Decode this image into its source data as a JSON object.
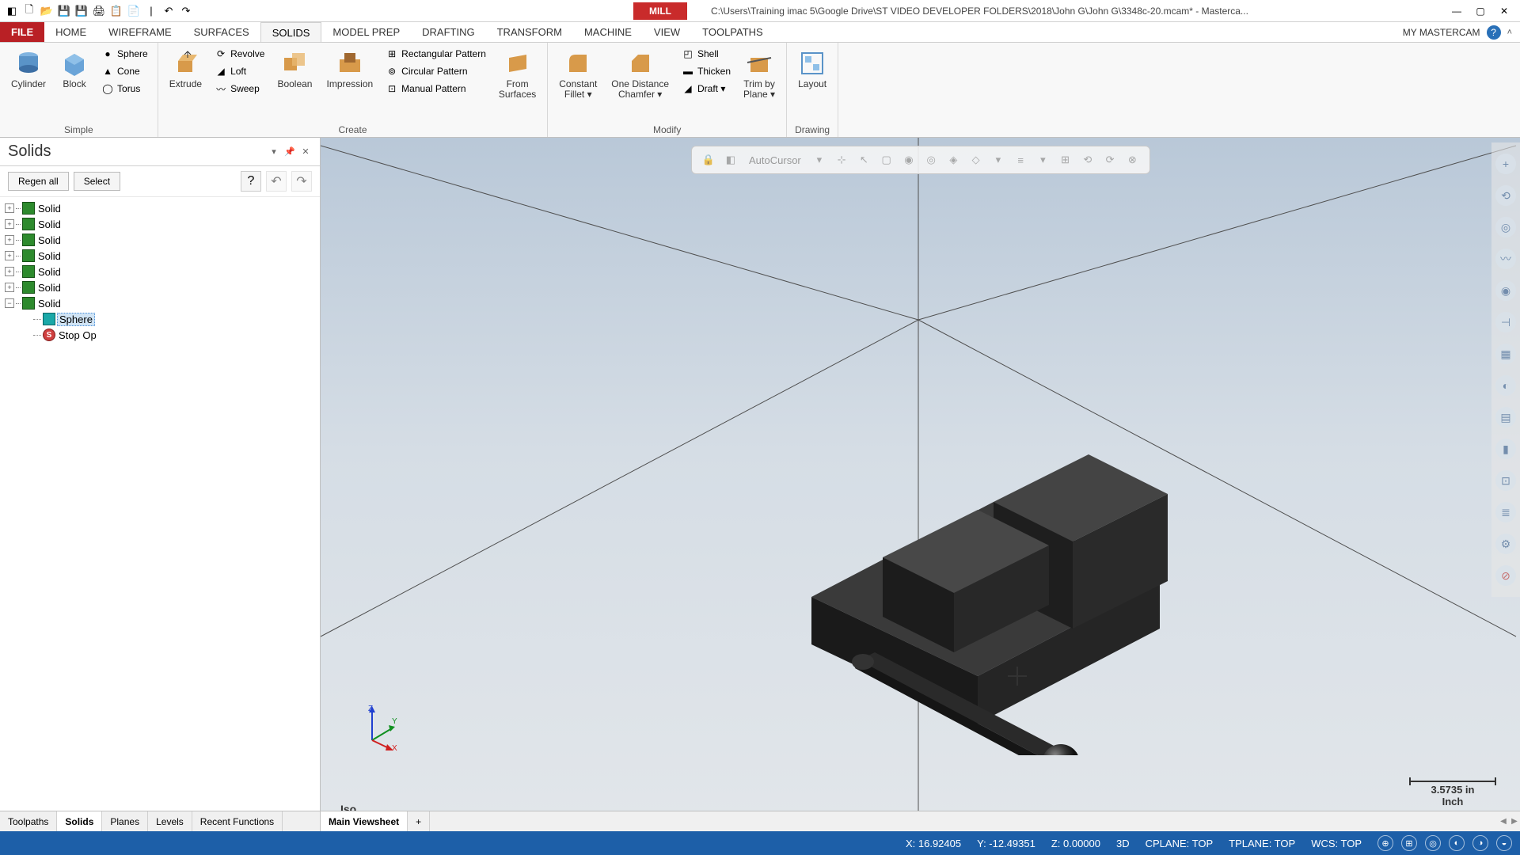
{
  "title_path": "C:\\Users\\Training imac 5\\Google Drive\\ST VIDEO DEVELOPER FOLDERS\\2018\\John G\\John G\\3348c-20.mcam* - Masterca...",
  "context_tab": "MILL",
  "my_mastercam": "MY MASTERCAM",
  "tabs": {
    "file": "FILE",
    "home": "HOME",
    "wireframe": "WIREFRAME",
    "surfaces": "SURFACES",
    "solids": "SOLIDS",
    "model_prep": "MODEL PREP",
    "drafting": "DRAFTING",
    "transform": "TRANSFORM",
    "machine": "MACHINE",
    "view": "VIEW",
    "toolpaths": "TOOLPATHS"
  },
  "ribbon": {
    "simple": {
      "label": "Simple",
      "cylinder": "Cylinder",
      "block": "Block",
      "sphere": "Sphere",
      "cone": "Cone",
      "torus": "Torus"
    },
    "create": {
      "label": "Create",
      "extrude": "Extrude",
      "revolve": "Revolve",
      "loft": "Loft",
      "sweep": "Sweep",
      "boolean": "Boolean",
      "impression": "Impression",
      "rect_pattern": "Rectangular Pattern",
      "circ_pattern": "Circular Pattern",
      "man_pattern": "Manual Pattern",
      "from_surfaces": "From\nSurfaces"
    },
    "modify": {
      "label": "Modify",
      "constant_fillet": "Constant\nFillet ▾",
      "one_distance_chamfer": "One Distance\nChamfer ▾",
      "shell": "Shell",
      "thicken": "Thicken",
      "draft": "Draft ▾",
      "trim_by_plane": "Trim by\nPlane ▾"
    },
    "drawing": {
      "label": "Drawing",
      "layout": "Layout"
    }
  },
  "panel": {
    "title": "Solids",
    "regen": "Regen all",
    "select": "Select",
    "items": [
      {
        "label": "Solid"
      },
      {
        "label": "Solid"
      },
      {
        "label": "Solid"
      },
      {
        "label": "Solid"
      },
      {
        "label": "Solid"
      },
      {
        "label": "Solid"
      },
      {
        "label": "Solid"
      }
    ],
    "child_sphere": "Sphere",
    "child_stop": "Stop Op"
  },
  "autocursor": "AutoCursor",
  "view": {
    "label": "Iso",
    "scale_value": "3.5735 in",
    "scale_unit": "Inch"
  },
  "bottom_tabs_left": {
    "toolpaths": "Toolpaths",
    "solids": "Solids",
    "planes": "Planes",
    "levels": "Levels",
    "recent": "Recent Functions"
  },
  "bottom_tabs_right": {
    "main": "Main Viewsheet",
    "plus": "+"
  },
  "status": {
    "x": "X: 16.92405",
    "y": "Y: -12.49351",
    "z": "Z: 0.00000",
    "mode": "3D",
    "cplane": "CPLANE: TOP",
    "tplane": "TPLANE: TOP",
    "wcs": "WCS: TOP"
  }
}
